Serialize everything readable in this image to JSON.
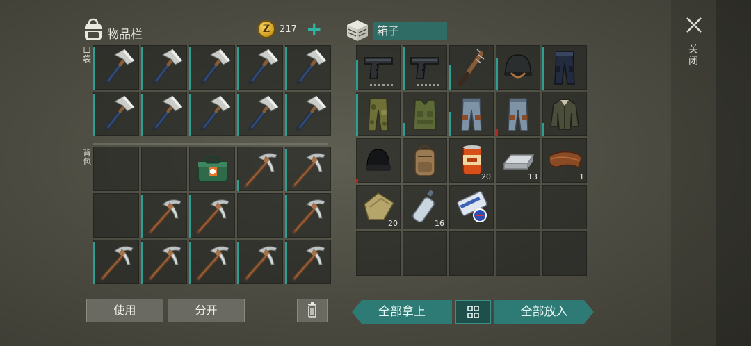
{
  "inventory": {
    "title": "物品栏",
    "coin_symbol": "Z",
    "coins": "217",
    "add_coins": "+",
    "pockets_label": "口袋",
    "backpack_label": "背包",
    "pockets": [
      {
        "icon": "hatchet-icon",
        "dur": 0.95
      },
      {
        "icon": "hatchet-icon",
        "dur": 0.95
      },
      {
        "icon": "hatchet-icon",
        "dur": 0.95
      },
      {
        "icon": "hatchet-icon",
        "dur": 0.95
      },
      {
        "icon": "hatchet-icon",
        "dur": 0.95
      },
      {
        "icon": "hatchet-icon",
        "dur": 0.95
      },
      {
        "icon": "hatchet-icon",
        "dur": 0.95
      },
      {
        "icon": "hatchet-icon",
        "dur": 0.95
      },
      {
        "icon": "hatchet-icon",
        "dur": 0.95
      },
      {
        "icon": "hatchet-icon",
        "dur": 0.95
      }
    ],
    "backpack": [
      {
        "icon": "empty"
      },
      {
        "icon": "empty"
      },
      {
        "icon": "first-aid-kit-icon"
      },
      {
        "icon": "pickaxe-icon",
        "dur": 0.25
      },
      {
        "icon": "pickaxe-icon",
        "dur": 0.95
      },
      {
        "icon": "empty"
      },
      {
        "icon": "pickaxe-icon",
        "dur": 0.95
      },
      {
        "icon": "pickaxe-icon",
        "dur": 0.95
      },
      {
        "icon": "empty"
      },
      {
        "icon": "pickaxe-icon",
        "dur": 0.95
      },
      {
        "icon": "pickaxe-icon",
        "dur": 0.95
      },
      {
        "icon": "pickaxe-icon",
        "dur": 0.95
      },
      {
        "icon": "pickaxe-icon",
        "dur": 0.95
      },
      {
        "icon": "pickaxe-icon",
        "dur": 0.95
      },
      {
        "icon": "pickaxe-icon",
        "dur": 0.95
      }
    ],
    "use_label": "使用",
    "split_label": "分开"
  },
  "box": {
    "title": "箱子",
    "items": [
      {
        "icon": "pistol-icon",
        "dur": 0.65,
        "dots": true
      },
      {
        "icon": "pistol-icon",
        "dur": 0.95,
        "dots": true
      },
      {
        "icon": "spiked-bat-icon",
        "dur": 0.55
      },
      {
        "icon": "helmet-icon",
        "dur": 0.7
      },
      {
        "icon": "pants-dark-icon",
        "dur": 0.95
      },
      {
        "icon": "camo-pants-icon",
        "dur": 0.95
      },
      {
        "icon": "tactical-vest-icon",
        "dur": 0.3
      },
      {
        "icon": "jeans-icon",
        "dur": 0.55
      },
      {
        "icon": "jeans-icon",
        "dur": 0.15,
        "red": true
      },
      {
        "icon": "jacket-icon",
        "dur": 0.3
      },
      {
        "icon": "beanie-icon",
        "dur": 0.1,
        "red": true
      },
      {
        "icon": "backpack-icon"
      },
      {
        "icon": "canned-food-icon",
        "qty": "20"
      },
      {
        "icon": "metal-ingot-icon",
        "qty": "13"
      },
      {
        "icon": "leather-icon",
        "qty": "1"
      },
      {
        "icon": "cloth-icon",
        "qty": "20"
      },
      {
        "icon": "water-bottle-icon",
        "qty": "16"
      },
      {
        "icon": "flyer-icon"
      },
      {
        "icon": "empty"
      },
      {
        "icon": "empty"
      },
      {
        "icon": "empty"
      },
      {
        "icon": "empty"
      },
      {
        "icon": "empty"
      },
      {
        "icon": "empty"
      },
      {
        "icon": "empty"
      }
    ],
    "take_all_label": "全部拿上",
    "put_all_label": "全部放入"
  },
  "close_label": "关闭",
  "colors": {
    "accent": "#2d7b74",
    "durability": "#2e9d93",
    "durability_low": "#b02a22"
  }
}
